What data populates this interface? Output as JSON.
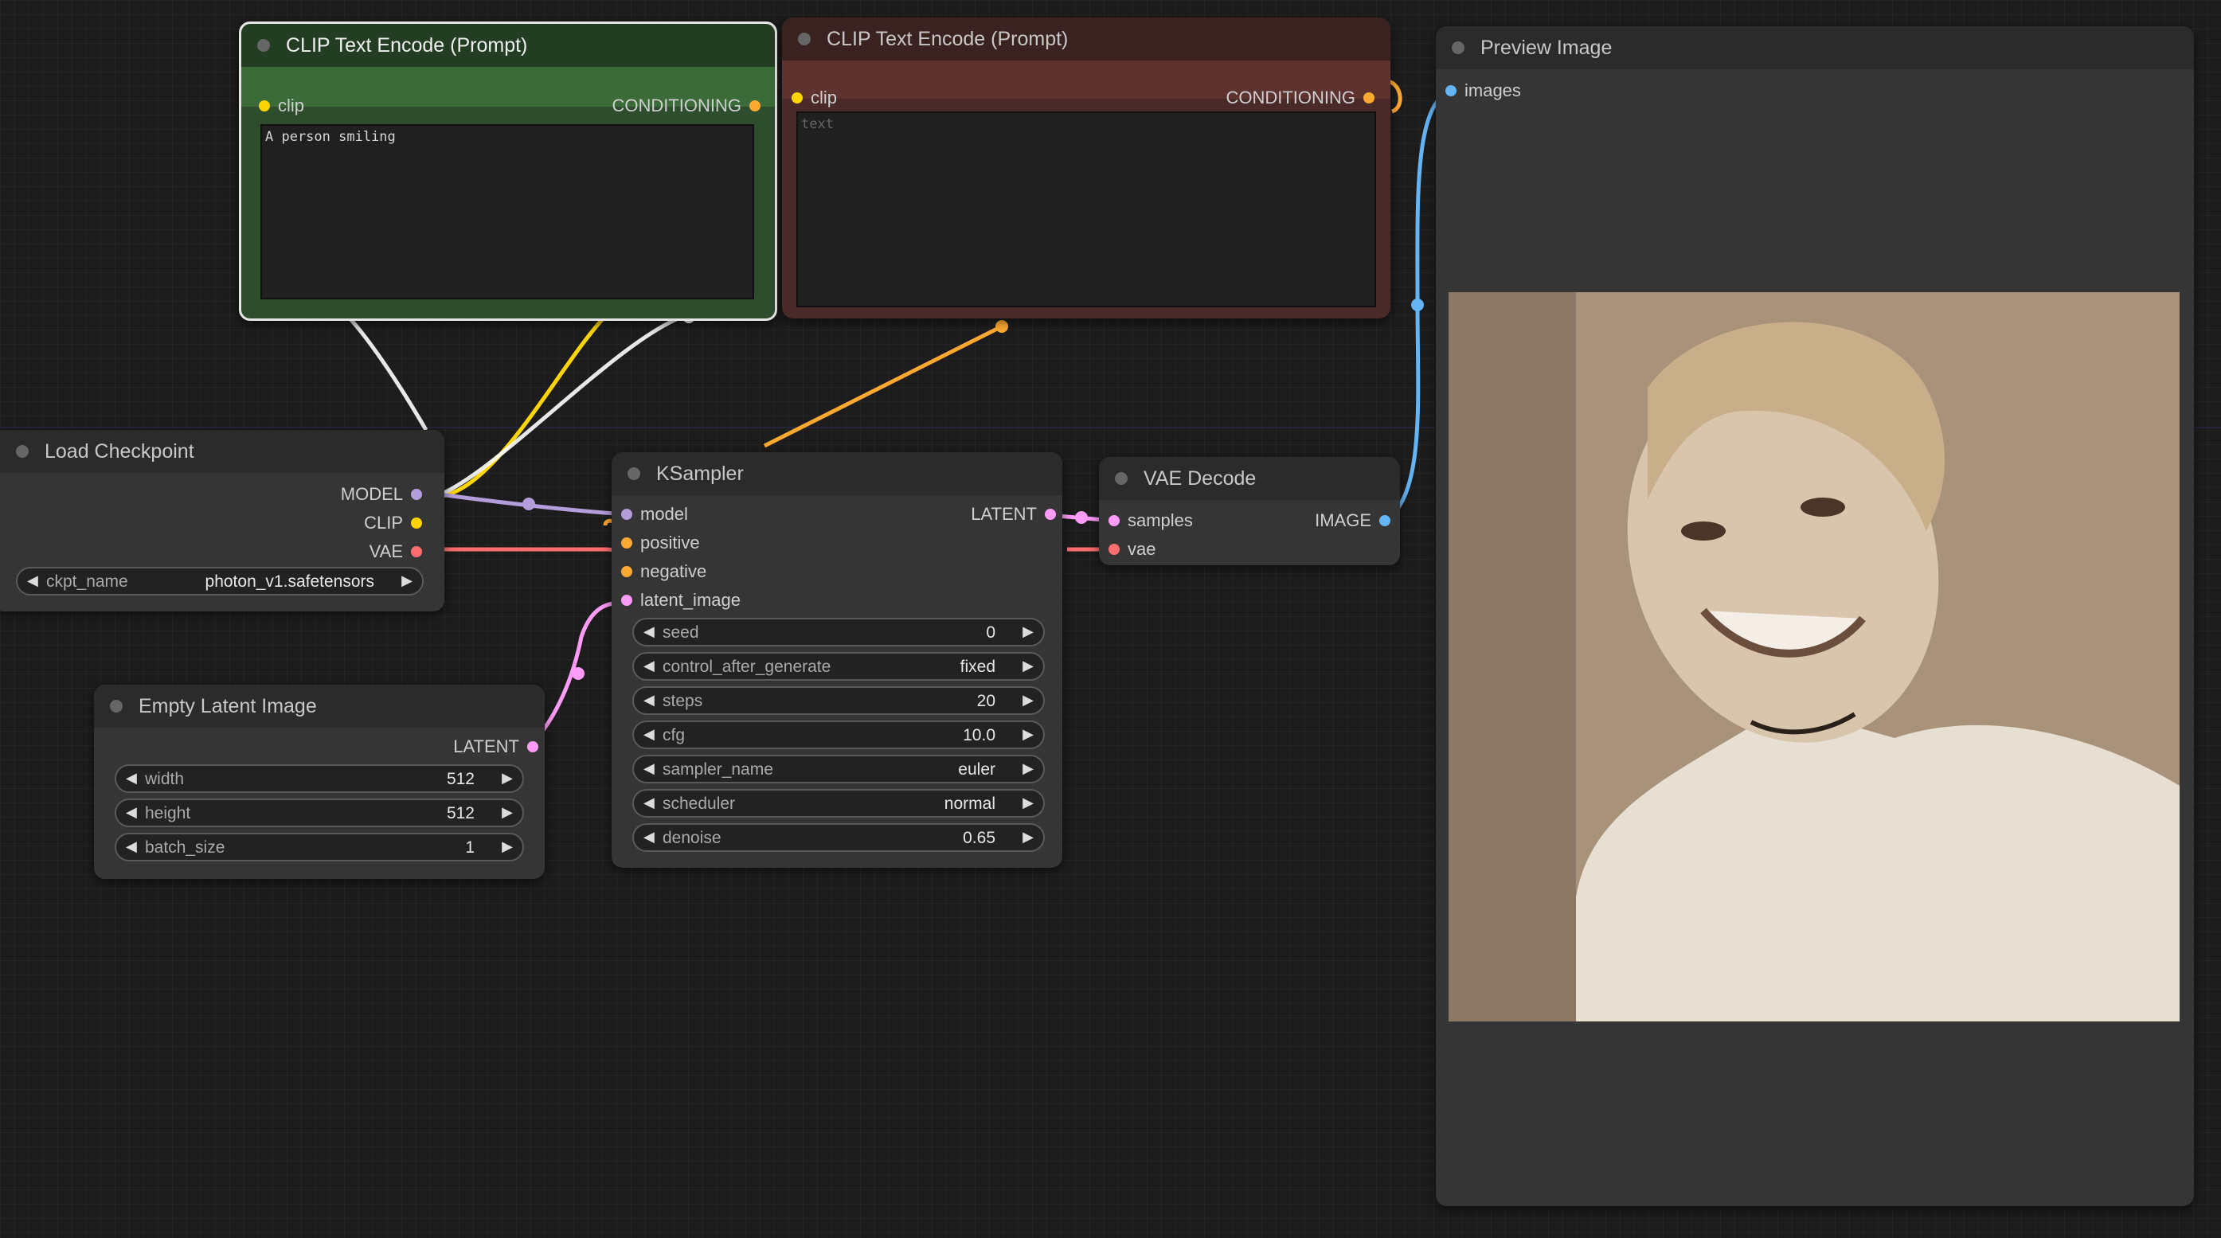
{
  "nodes": {
    "clip_positive": {
      "title": "CLIP Text Encode (Prompt)",
      "input_clip": "clip",
      "output_conditioning": "CONDITIONING",
      "text_value": "A person smiling",
      "color": "#2d4d2c"
    },
    "clip_negative": {
      "title": "CLIP Text Encode (Prompt)",
      "input_clip": "clip",
      "output_conditioning": "CONDITIONING",
      "text_placeholder": "text",
      "color": "#4a2a28"
    },
    "preview_image": {
      "title": "Preview Image",
      "input_images": "images",
      "image_alt": "sepia photo of a smiling young woman with short hair in a light t-shirt"
    },
    "load_checkpoint": {
      "title": "Load Checkpoint",
      "output_model": "MODEL",
      "output_clip": "CLIP",
      "output_vae": "VAE",
      "ckpt_label": "ckpt_name",
      "ckpt_value": "photon_v1.safetensors"
    },
    "ksampler": {
      "title": "KSampler",
      "input_model": "model",
      "input_positive": "positive",
      "input_negative": "negative",
      "input_latent": "latent_image",
      "output_latent": "LATENT",
      "widgets": [
        {
          "label": "seed",
          "value": "0"
        },
        {
          "label": "control_after_generate",
          "value": "fixed"
        },
        {
          "label": "steps",
          "value": "20"
        },
        {
          "label": "cfg",
          "value": "10.0"
        },
        {
          "label": "sampler_name",
          "value": "euler"
        },
        {
          "label": "scheduler",
          "value": "normal"
        },
        {
          "label": "denoise",
          "value": "0.65"
        }
      ]
    },
    "vae_decode": {
      "title": "VAE Decode",
      "input_samples": "samples",
      "input_vae": "vae",
      "output_image": "IMAGE"
    },
    "empty_latent": {
      "title": "Empty Latent Image",
      "output_latent": "LATENT",
      "widgets": [
        {
          "label": "width",
          "value": "512"
        },
        {
          "label": "height",
          "value": "512"
        },
        {
          "label": "batch_size",
          "value": "1"
        }
      ]
    }
  },
  "colors": {
    "model": "#b39ddb",
    "clip": "#ffd500",
    "vae": "#ff6e6e",
    "conditioning": "#ffa931",
    "latent": "#ff9cf9",
    "image": "#64b5f6"
  }
}
